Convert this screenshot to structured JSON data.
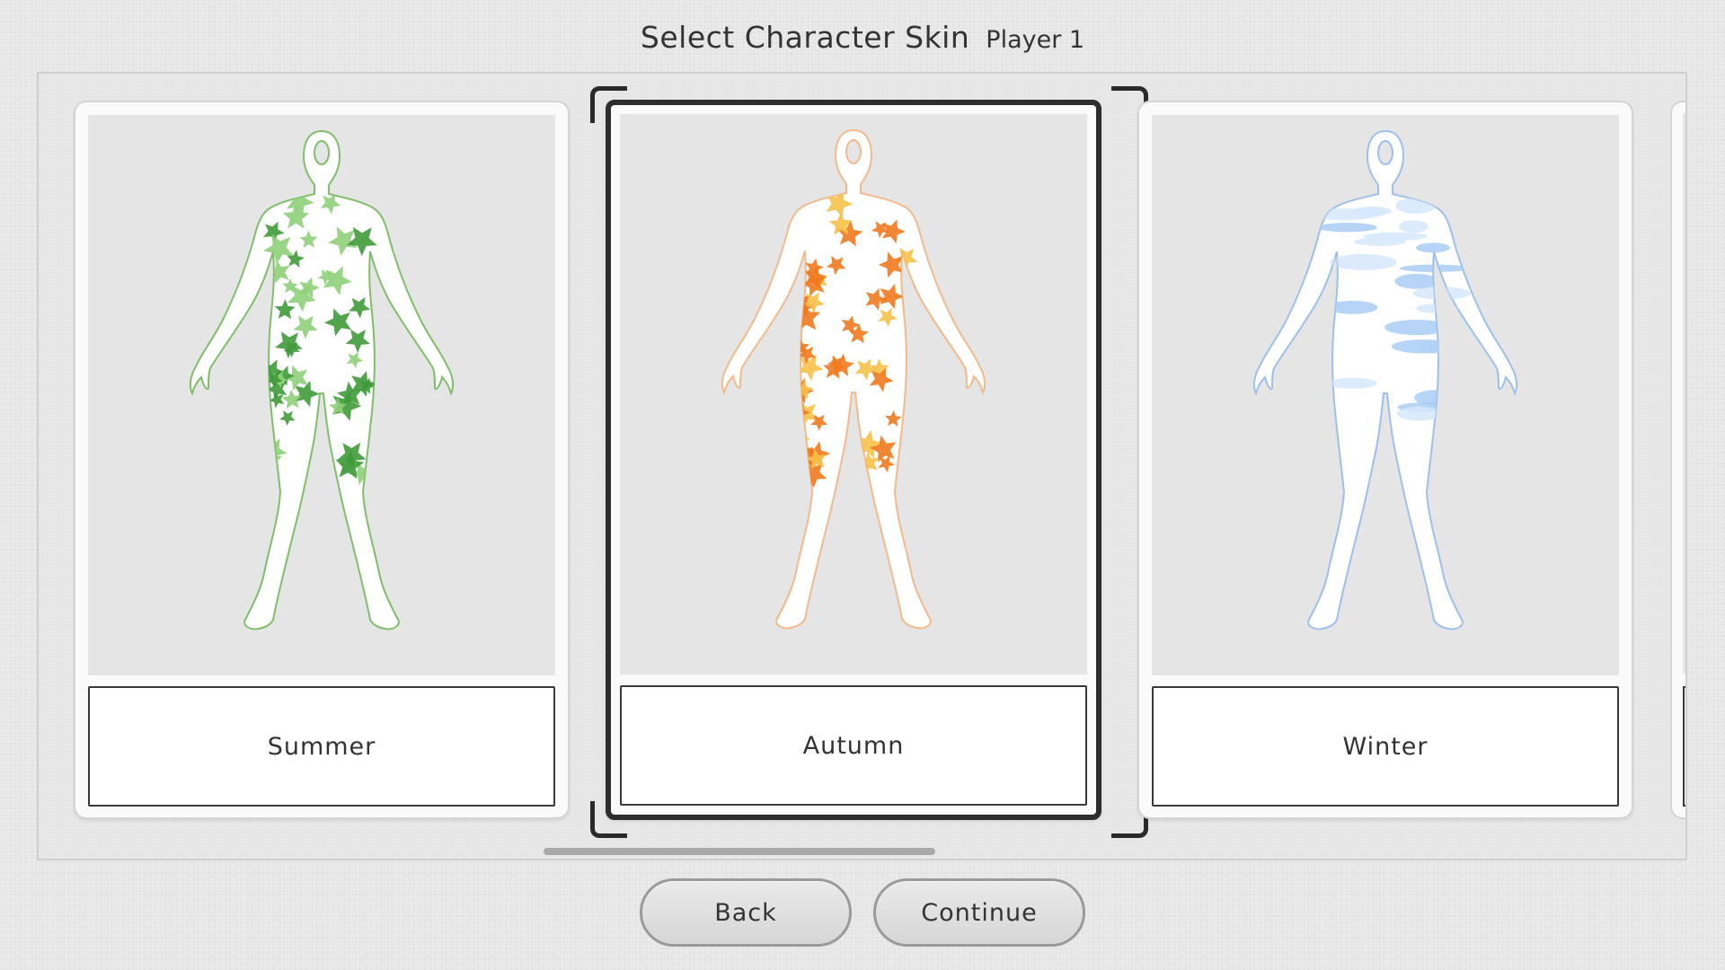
{
  "header": {
    "title": "Select Character Skin",
    "player": "Player 1"
  },
  "skins": [
    {
      "label": "Summer",
      "selected": false,
      "pattern": "leaves",
      "colors": {
        "outline": "#7fbf6a",
        "fill_dark": "#3f9a3a",
        "fill_light": "#8fd07a"
      }
    },
    {
      "label": "Autumn",
      "selected": true,
      "pattern": "maple-leaves",
      "colors": {
        "outline": "#f3b98a",
        "fill_dark": "#f07a1e",
        "fill_light": "#f7c14a"
      }
    },
    {
      "label": "Winter",
      "selected": false,
      "pattern": "water-ripples",
      "colors": {
        "outline": "#9cc0ec",
        "fill_dark": "#a9cdf3",
        "fill_light": "#d5e7fb"
      }
    }
  ],
  "buttons": {
    "back": "Back",
    "continue": "Continue"
  },
  "colors": {
    "background": "#e6e6e6",
    "selection_frame": "#2d2d2d"
  }
}
